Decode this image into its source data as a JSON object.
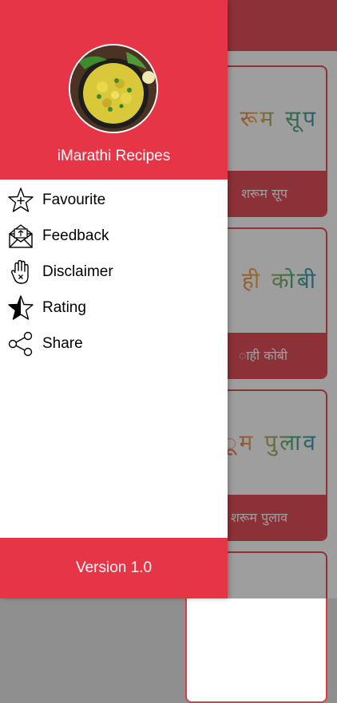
{
  "drawer": {
    "app_name": "iMarathi Recipes",
    "items": [
      {
        "label": "Favourite",
        "icon": "star-plus-icon"
      },
      {
        "label": "Feedback",
        "icon": "envelope-icon"
      },
      {
        "label": "Disclaimer",
        "icon": "hand-icon"
      },
      {
        "label": "Rating",
        "icon": "half-star-icon"
      },
      {
        "label": "Share",
        "icon": "share-icon"
      }
    ],
    "version": "Version 1.0"
  },
  "background_list": {
    "cards": [
      {
        "art_text": "रूम सूप",
        "title": "शरूम सूप"
      },
      {
        "art_text": "ही कोबी",
        "title": "ाही कोबी"
      },
      {
        "art_text": "ूम पुलाव",
        "title": "शरूम पुलाव"
      }
    ]
  },
  "colors": {
    "accent": "#e63546",
    "scrim": "rgba(40,40,40,0.45)"
  }
}
